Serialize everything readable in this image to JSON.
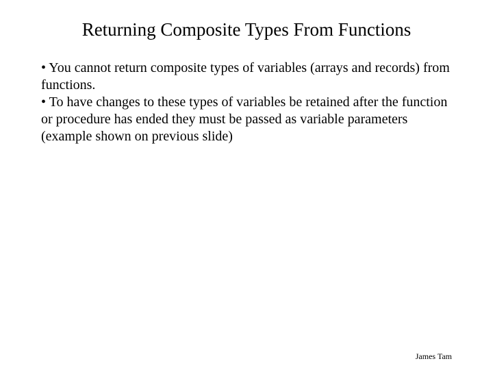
{
  "slide": {
    "title": "Returning Composite Types From Functions",
    "bullets": [
      "You cannot return composite types of variables (arrays and records) from functions.",
      "To have changes to these types of variables be retained after the function or procedure has ended they must be passed as variable parameters (example shown on previous slide)"
    ],
    "footer": "James Tam"
  }
}
